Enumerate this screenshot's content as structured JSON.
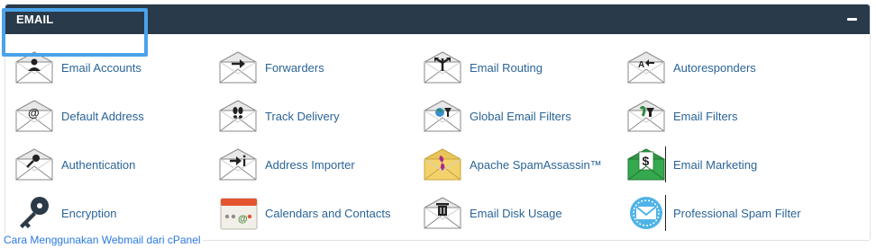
{
  "panel": {
    "title": "EMAIL",
    "collapse_icon": "minus-icon"
  },
  "items": [
    {
      "label": "Email Accounts",
      "icon": "user-envelope-icon"
    },
    {
      "label": "Forwarders",
      "icon": "arrow-envelope-icon"
    },
    {
      "label": "Email Routing",
      "icon": "routing-envelope-icon"
    },
    {
      "label": "Autoresponders",
      "icon": "autoresponder-envelope-icon"
    },
    {
      "label": "Default Address",
      "icon": "at-envelope-icon"
    },
    {
      "label": "Track Delivery",
      "icon": "footprints-envelope-icon"
    },
    {
      "label": "Global Email Filters",
      "icon": "globe-filter-envelope-icon"
    },
    {
      "label": "Email Filters",
      "icon": "filter-envelope-icon"
    },
    {
      "label": "Authentication",
      "icon": "key-envelope-icon"
    },
    {
      "label": "Address Importer",
      "icon": "import-envelope-icon"
    },
    {
      "label": "Apache SpamAssassin™",
      "icon": "spamassassin-envelope-icon"
    },
    {
      "label": "Email Marketing",
      "icon": "dollar-envelope-icon"
    },
    {
      "label": "Encryption",
      "icon": "key-icon"
    },
    {
      "label": "Calendars and Contacts",
      "icon": "calendar-icon"
    },
    {
      "label": "Email Disk Usage",
      "icon": "trash-envelope-icon"
    },
    {
      "label": "Professional Spam Filter",
      "icon": "spam-filter-icon"
    }
  ],
  "footer_link": "Cara Menggunakan Webmail dari cPanel",
  "colors": {
    "header_bg": "#293a4a",
    "link": "#2a6496",
    "highlight": "#4aa3ea"
  }
}
